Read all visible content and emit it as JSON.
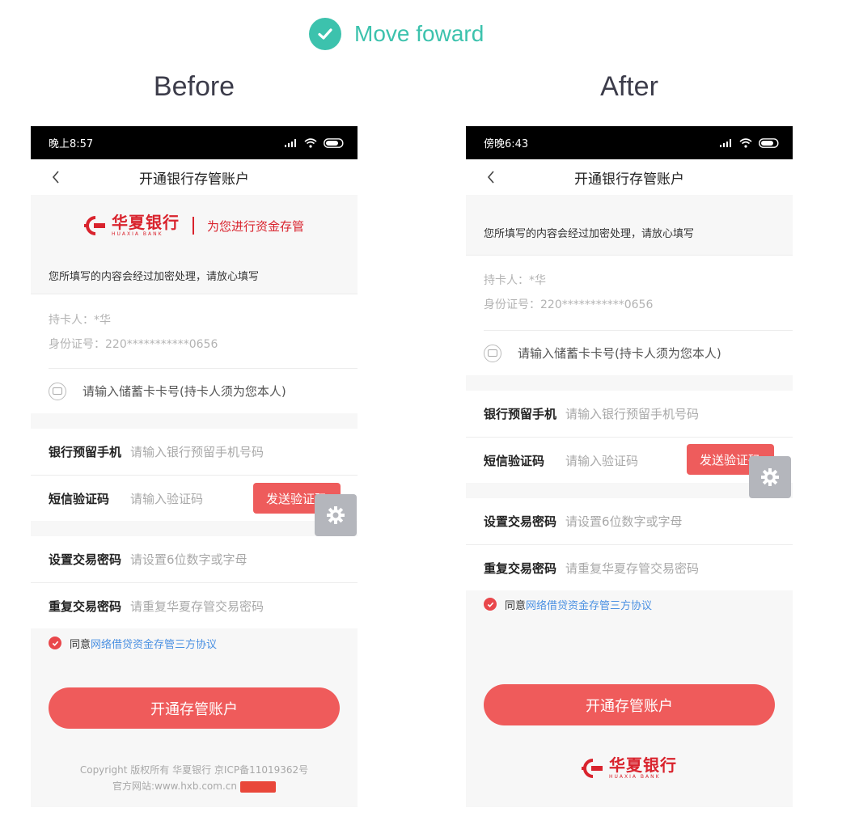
{
  "header": {
    "label": "Move foward",
    "accent": "#3cc2ad"
  },
  "columns": {
    "before_title": "Before",
    "after_title": "After"
  },
  "before": {
    "status_time": "晚上8:57",
    "nav_title": "开通银行存管账户",
    "brand_name_cn": "华夏银行",
    "brand_name_en": "HUAXIA BANK",
    "brand_slogan": "为您进行资金存管",
    "notice": "您所填写的内容会经过加密处理，请放心填写",
    "holder": "持卡人：*华",
    "id_number": "身份证号：220***********0656",
    "card_placeholder": "请输入储蓄卡卡号(持卡人须为您本人)",
    "phone_label": "银行预留手机",
    "phone_placeholder": "请输入银行预留手机号码",
    "sms_label": "短信验证码",
    "sms_placeholder": "请输入验证码",
    "sms_button": "发送验证码",
    "pwd_label": "设置交易密码",
    "pwd_placeholder": "请设置6位数字或字母",
    "pwd2_label": "重复交易密码",
    "pwd2_placeholder": "请重复华夏存管交易密码",
    "agree_prefix": "同意",
    "agree_link": "网络借贷资金存管三方协议",
    "submit": "开通存管账户",
    "copyright_line1": "Copyright 版权所有 华夏银行 京ICP备11019362号",
    "copyright_line2": "官方网站:www.hxb.com.cn"
  },
  "after": {
    "status_time": "傍晚6:43",
    "nav_title": "开通银行存管账户",
    "notice": "您所填写的内容会经过加密处理，请放心填写",
    "holder": "持卡人：*华",
    "id_number": "身份证号：220***********0656",
    "card_placeholder": "请输入储蓄卡卡号(持卡人须为您本人)",
    "phone_label": "银行预留手机",
    "phone_placeholder": "请输入银行预留手机号码",
    "sms_label": "短信验证码",
    "sms_placeholder": "请输入验证码",
    "sms_button": "发送验证码",
    "pwd_label": "设置交易密码",
    "pwd_placeholder": "请设置6位数字或字母",
    "pwd2_label": "重复交易密码",
    "pwd2_placeholder": "请重复华夏存管交易密码",
    "agree_prefix": "同意",
    "agree_link": "网络借贷资金存管三方协议",
    "submit": "开通存管账户",
    "brand_name_cn": "华夏银行",
    "brand_name_en": "HUAXIA BANK"
  },
  "colors": {
    "brand_red": "#d9232d",
    "button_red": "#ef5b5b",
    "link_blue": "#4a90e2",
    "gear_gray": "#b4b6bc"
  }
}
